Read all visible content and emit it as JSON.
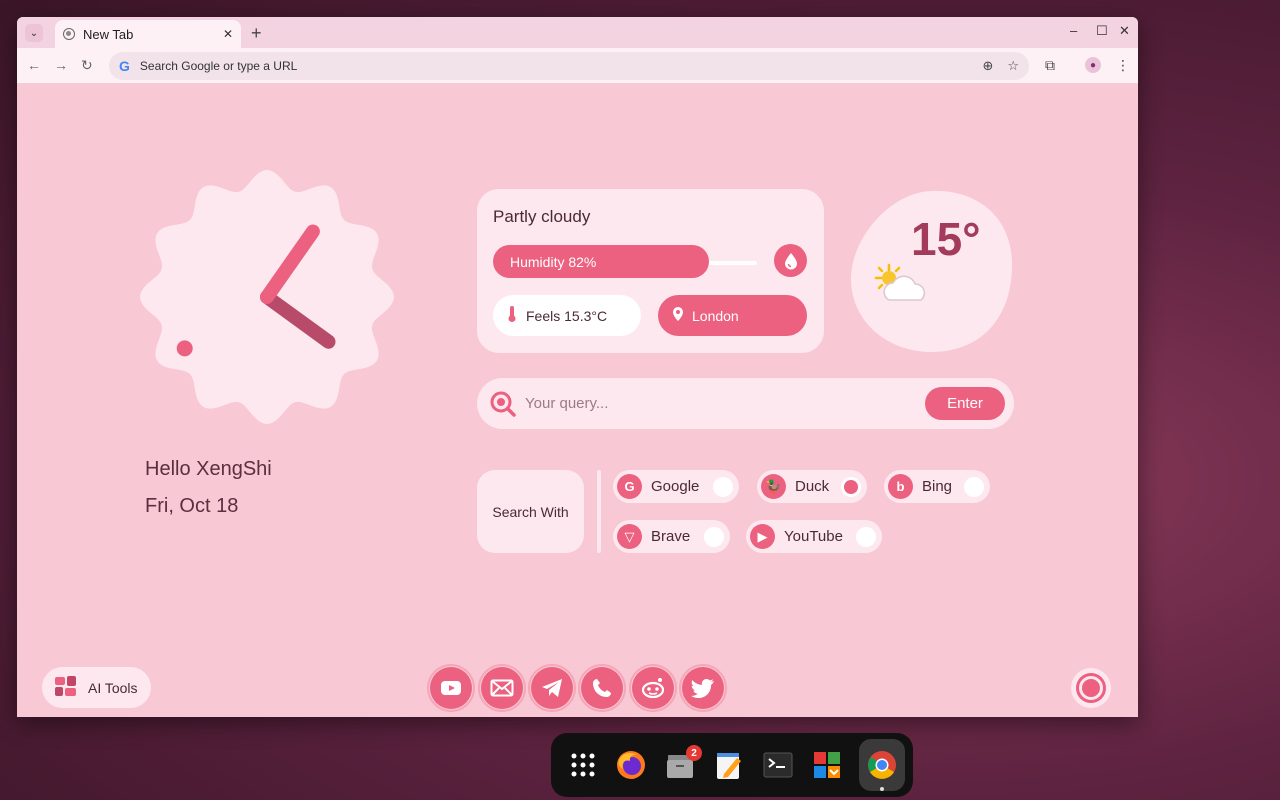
{
  "browser": {
    "tab_title": "New Tab",
    "close_glyph": "✕",
    "new_tab_glyph": "+",
    "omnibox_placeholder": "Search Google or type a URL",
    "google_logo_text": "G"
  },
  "clock": {
    "hour_hand_angle_deg": 35,
    "minute_hand_angle_deg": 126,
    "second_dot_angle_deg": 238
  },
  "greeting": {
    "hello": "Hello XengShi",
    "date": "Fri, Oct 18"
  },
  "weather": {
    "condition": "Partly cloudy",
    "humidity_label": "Humidity 82%",
    "humidity_percent": 82,
    "feels_like": "Feels 15.3°C",
    "location": "London",
    "temperature": "15°"
  },
  "search": {
    "placeholder": "Your query...",
    "enter_label": "Enter",
    "search_with_label": "Search With",
    "engines": [
      {
        "name": "Google",
        "selected": false
      },
      {
        "name": "Duck",
        "selected": true
      },
      {
        "name": "Bing",
        "selected": false
      },
      {
        "name": "Brave",
        "selected": false
      },
      {
        "name": "YouTube",
        "selected": false
      }
    ]
  },
  "ai_tools_label": "AI Tools",
  "shortcuts": [
    "youtube-icon",
    "mail-icon",
    "telegram-icon",
    "whatsapp-icon",
    "reddit-icon",
    "twitter-icon"
  ],
  "shelf": {
    "apps": [
      "launcher-icon",
      "firefox-icon",
      "files-icon",
      "text-editor-icon",
      "terminal-icon",
      "app-store-icon",
      "chrome-icon"
    ],
    "files_badge": "2"
  },
  "colors": {
    "accent": "#ec6080",
    "card": "#fde8ef",
    "page_bg": "#f8c8d4",
    "text": "#4a2a34"
  }
}
